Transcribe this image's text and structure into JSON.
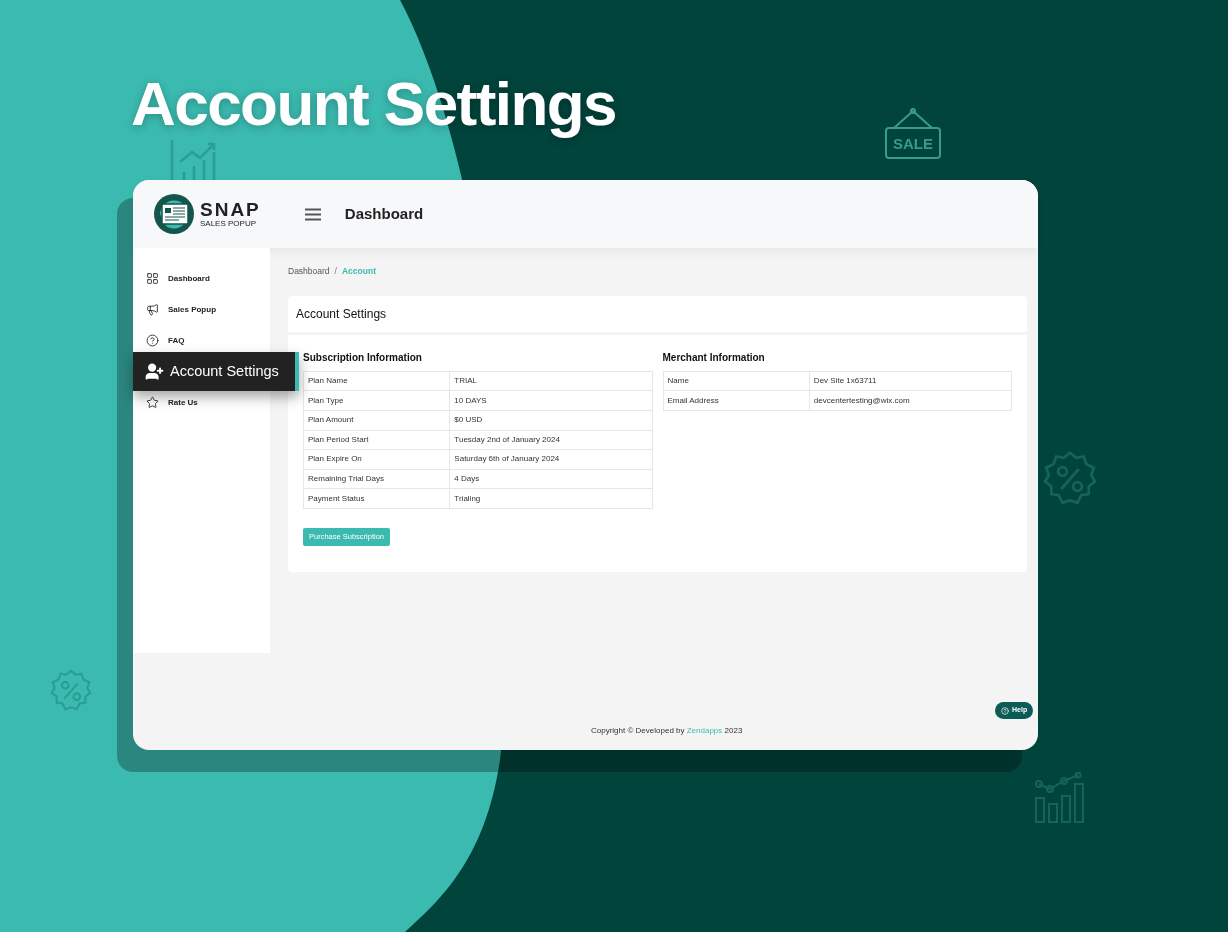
{
  "title": "Account Settings",
  "decor": {
    "sale_sign": "SALE"
  },
  "app": {
    "logo": {
      "name": "SNAP",
      "tagline": "SALES POPUP"
    },
    "header_title": "Dashboard",
    "sidebar": {
      "items": [
        {
          "label": "Dashboard",
          "selected": false
        },
        {
          "label": "Sales Popup",
          "selected": false
        },
        {
          "label": "FAQ",
          "selected": false
        },
        {
          "label": "Account Settings",
          "selected": true
        },
        {
          "label": "Rate Us",
          "selected": false
        }
      ]
    },
    "breadcrumb": {
      "items": [
        {
          "label": "Dashboard",
          "current": false
        },
        {
          "label": "Account",
          "current": true
        }
      ],
      "separator": "/"
    },
    "card": {
      "title": "Account Settings",
      "subscription": {
        "heading": "Subscription Information",
        "rows": [
          [
            "Plan Name",
            "TRIAL"
          ],
          [
            "Plan Type",
            "10 DAYS"
          ],
          [
            "Plan Amount",
            "$0 USD"
          ],
          [
            "Plan Period Start",
            "Tuesday 2nd of January 2024"
          ],
          [
            "Plan Expire On",
            "Saturday 6th of January 2024"
          ],
          [
            "Remaining Trial Days",
            "4 Days"
          ],
          [
            "Payment Status",
            "Trialing"
          ]
        ]
      },
      "merchant": {
        "heading": "Merchant Information",
        "rows": [
          [
            "Name",
            "Dev Site 1x63711"
          ],
          [
            "Email Address",
            "devcentertesting@wix.com"
          ]
        ]
      },
      "button": "Purchase Subscription"
    },
    "footer": {
      "prefix": "Copyright © Developed by",
      "link": "Zendapps",
      "suffix": "2023"
    },
    "help_button": "Help"
  }
}
